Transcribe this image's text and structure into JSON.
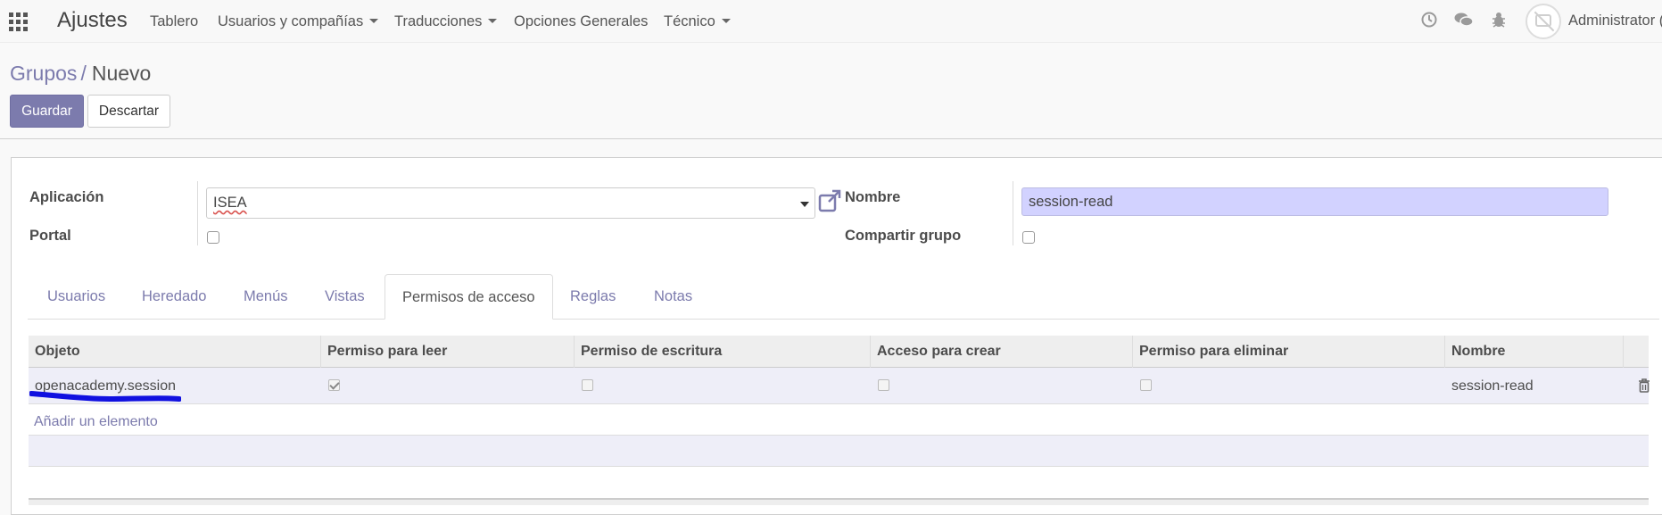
{
  "navbar": {
    "brand": "Ajustes",
    "menu": [
      {
        "label": "Tablero",
        "dropdown": false
      },
      {
        "label": "Usuarios y compañías",
        "dropdown": true
      },
      {
        "label": "Traducciones",
        "dropdown": true
      },
      {
        "label": "Opciones Generales",
        "dropdown": false
      },
      {
        "label": "Técnico",
        "dropdown": true
      }
    ],
    "icons": [
      "clock-icon",
      "chat-icon",
      "bug-icon"
    ],
    "user": "Administrator ("
  },
  "breadcrumb": {
    "parent": "Grupos",
    "separator": "/",
    "current": "Nuevo"
  },
  "buttons": {
    "save": "Guardar",
    "discard": "Descartar"
  },
  "form": {
    "application_label": "Aplicación",
    "application_value": "ISEA",
    "portal_label": "Portal",
    "portal_checked": false,
    "name_label": "Nombre",
    "name_value": "session-read",
    "share_label": "Compartir grupo",
    "share_checked": false
  },
  "tabs": [
    {
      "label": "Usuarios",
      "active": false
    },
    {
      "label": "Heredado",
      "active": false
    },
    {
      "label": "Menús",
      "active": false
    },
    {
      "label": "Vistas",
      "active": false
    },
    {
      "label": "Permisos de acceso",
      "active": true
    },
    {
      "label": "Reglas",
      "active": false
    },
    {
      "label": "Notas",
      "active": false
    }
  ],
  "access_table": {
    "columns": [
      "Objeto",
      "Permiso para leer",
      "Permiso de escritura",
      "Acceso para crear",
      "Permiso para eliminar",
      "Nombre"
    ],
    "rows": [
      {
        "object": "openacademy.session",
        "read": true,
        "write": false,
        "create": false,
        "unlink": false,
        "name": "session-read"
      }
    ],
    "add_label": "Añadir un elemento"
  },
  "colors": {
    "accent": "#7c7bad",
    "highlight_row": "#eeeef8",
    "input_required": "#d2d2ff",
    "annotation": "#0000ff"
  }
}
